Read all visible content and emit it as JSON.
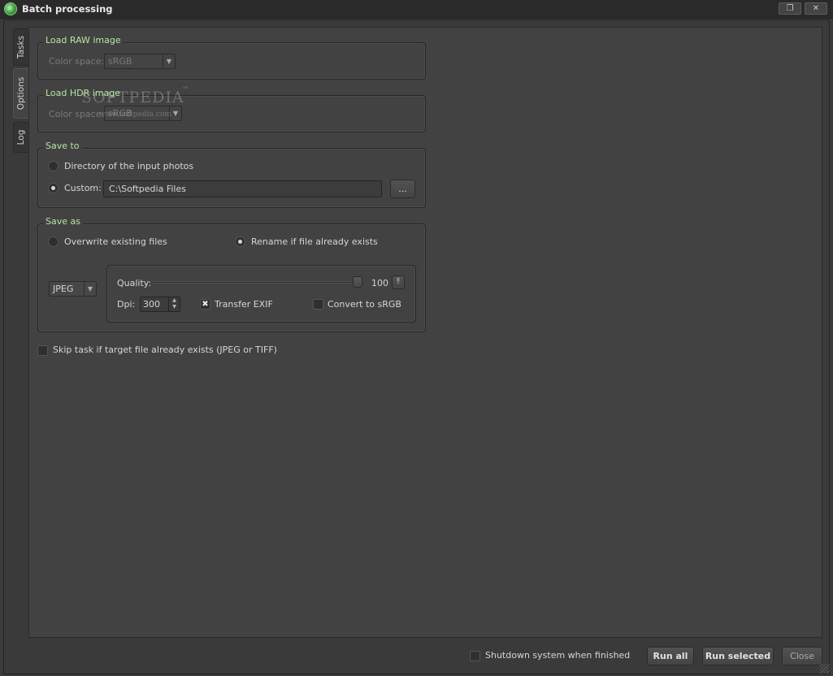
{
  "window": {
    "title": "Batch processing",
    "restore_glyph": "❐",
    "close_glyph": "✕"
  },
  "tabs": [
    {
      "label": "Tasks"
    },
    {
      "label": "Options"
    },
    {
      "label": "Log"
    }
  ],
  "load_raw": {
    "title": "Load RAW image",
    "color_space_label": "Color space:",
    "color_space_value": "sRGB"
  },
  "load_hdr": {
    "title": "Load HDR image",
    "color_space_label": "Color space:",
    "color_space_value": "sRGB"
  },
  "watermark": {
    "brand": "SOFTPEDIA",
    "tm": "™",
    "url": "www.softpedia.com"
  },
  "save_to": {
    "title": "Save to",
    "option_directory": "Directory of the input photos",
    "option_custom": "Custom:",
    "custom_path": "C:\\Softpedia Files",
    "browse_label": "...",
    "selected": "custom"
  },
  "save_as": {
    "title": "Save as",
    "option_overwrite": "Overwrite existing files",
    "option_rename": "Rename if file already exists",
    "selected": "rename",
    "format": "JPEG",
    "quality_label": "Quality:",
    "quality_value": "100",
    "quality_fraction": 1.0,
    "dpi_label": "Dpi:",
    "dpi_value": "300",
    "transfer_exif_label": "Transfer EXIF",
    "transfer_exif_checked": true,
    "convert_srgb_label": "Convert to sRGB",
    "convert_srgb_checked": false
  },
  "skip_task": {
    "label": "Skip task if target file already exists (JPEG or TIFF)",
    "checked": false
  },
  "footer": {
    "shutdown_label": "Shutdown system when finished",
    "shutdown_checked": false,
    "run_all": "Run all",
    "run_selected": "Run selected",
    "close": "Close"
  },
  "colors": {
    "group_title": "#b5e6a0",
    "background": "#424242",
    "titlebar": "#2a2a2a"
  }
}
